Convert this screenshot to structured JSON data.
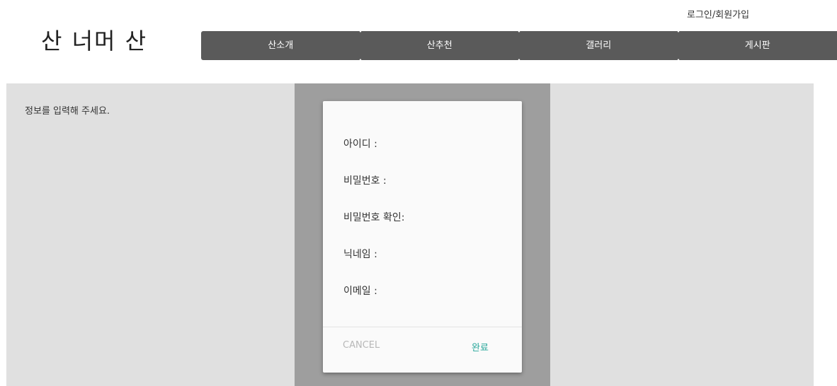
{
  "header": {
    "login_link": "로그인/회원가입",
    "site_title": "산 너머 산"
  },
  "nav": {
    "items": [
      {
        "label": "산소개"
      },
      {
        "label": "산추천"
      },
      {
        "label": "갤러리"
      },
      {
        "label": "게시판"
      }
    ]
  },
  "main": {
    "instruction": "정보를 입력해 주세요."
  },
  "dialog": {
    "fields": [
      {
        "label": "아이디 :"
      },
      {
        "label": "비밀번호 :"
      },
      {
        "label": "비밀번호 확인:"
      },
      {
        "label": "닉네임 :"
      },
      {
        "label": "이메일 :"
      }
    ],
    "cancel_label": "CANCEL",
    "confirm_label": "완료"
  },
  "colors": {
    "nav_background": "#5a5a5a",
    "content_background": "#e0e0e0",
    "overlay": "#9e9e9e",
    "dialog_background": "#fafafa",
    "accent": "#26a69a",
    "disabled_text": "#b8b8b8"
  }
}
